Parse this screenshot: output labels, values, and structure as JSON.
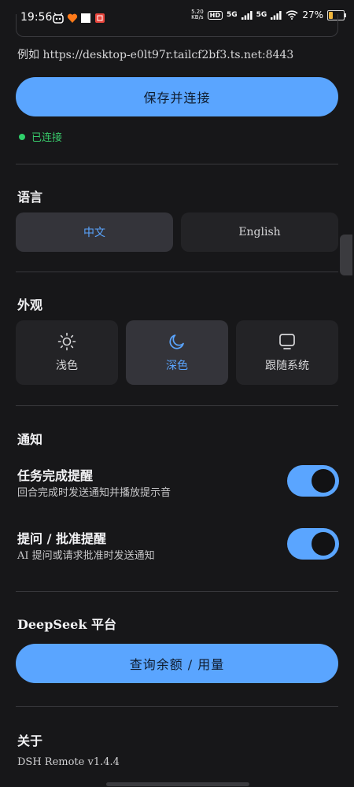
{
  "status_bar": {
    "time": "19:56",
    "net_speed_value": "5.20",
    "net_speed_unit": "KB/s",
    "hd_label": "HD",
    "signal1_label": "5G",
    "signal2_label": "5G",
    "battery": "27%",
    "battery_fraction": 0.27
  },
  "server": {
    "hint": "例如 https://desktop-e0lt97r.tailcf2bf3.ts.net:8443",
    "save_label": "保存并连接",
    "status": "已连接"
  },
  "language": {
    "title": "语言",
    "options": [
      "中文",
      "English"
    ],
    "selected_index": 0
  },
  "appearance": {
    "title": "外观",
    "options": [
      {
        "label": "浅色",
        "icon": "sun-icon"
      },
      {
        "label": "深色",
        "icon": "moon-icon"
      },
      {
        "label": "跟随系统",
        "icon": "monitor-icon"
      }
    ],
    "selected_index": 1
  },
  "notifications": {
    "title": "通知",
    "items": [
      {
        "title": "任务完成提醒",
        "desc": "回合完成时发送通知并播放提示音",
        "enabled": true
      },
      {
        "title": "提问 / 批准提醒",
        "desc": "AI 提问或请求批准时发送通知",
        "enabled": true
      }
    ]
  },
  "deepseek": {
    "title": "DeepSeek 平台",
    "button_label": "查询余额 / 用量"
  },
  "about": {
    "title": "关于",
    "version": "DSH Remote v1.4.4"
  },
  "colors": {
    "accent": "#5aa5ff",
    "background": "#171719",
    "card": "#232326",
    "connected": "#2fd06a"
  }
}
